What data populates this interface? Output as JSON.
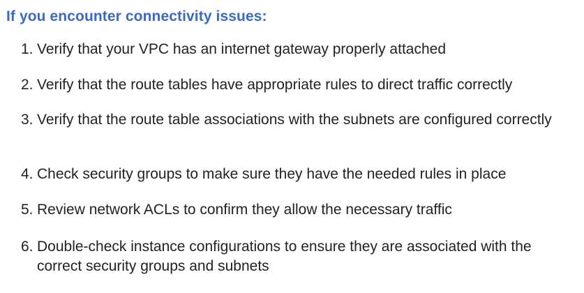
{
  "heading": "If you encounter connectivity issues:",
  "steps": [
    {
      "number": "1.",
      "text": "Verify that your VPC has an internet gateway properly attached"
    },
    {
      "number": "2.",
      "text": "Verify that the route tables have appropriate rules to direct traffic correctly"
    },
    {
      "number": "3.",
      "text": "Verify that the route table associations with the subnets are configured correctly"
    },
    {
      "number": "4.",
      "text": "Check security groups to make sure they have the needed rules in place"
    },
    {
      "number": "5.",
      "text": "Review network ACLs to confirm they allow the necessary traffic"
    },
    {
      "number": "6.",
      "text": "Double-check instance configurations to ensure they are associated with the correct security groups and subnets"
    }
  ],
  "colors": {
    "heading": "#3a6bc0",
    "text": "#222222",
    "background": "#ffffff"
  }
}
